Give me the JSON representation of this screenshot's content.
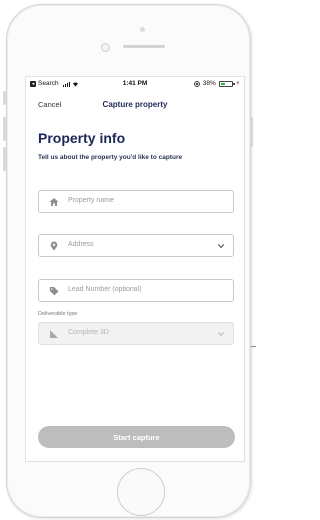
{
  "status_bar": {
    "back_app": "Search",
    "time": "1:41 PM",
    "battery": "38%",
    "battery_level": 0.38
  },
  "nav": {
    "cancel": "Cancel",
    "title": "Capture property"
  },
  "page": {
    "title": "Property info",
    "subtitle": "Tell us about the property you'd like to capture"
  },
  "form": {
    "property_name_placeholder": "Property name",
    "address_placeholder": "Address",
    "lead_number_placeholder": "Lead Number (optional)",
    "deliverable_label": "Deliverable type",
    "deliverable_value": "Complete 3D"
  },
  "actions": {
    "start_capture": "Start capture"
  },
  "colors": {
    "primary_text": "#1c2657",
    "disabled_button": "#bdbdbd",
    "battery_fill": "#2fb64b"
  },
  "icons": {
    "property_name": "house-icon",
    "address": "map-pin-icon",
    "lead_number": "tag-icon",
    "deliverable": "ruler-icon",
    "dropdown": "chevron-down-icon"
  }
}
